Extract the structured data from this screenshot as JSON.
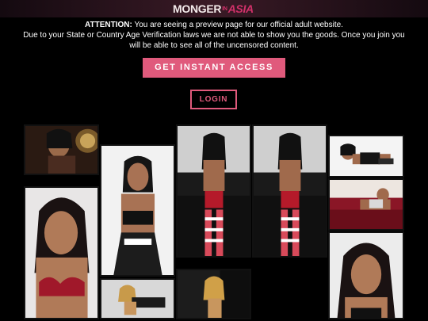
{
  "logo": {
    "part1": "MONGER",
    "part2": "IN",
    "part3": "ASIA"
  },
  "notice": {
    "attention_label": "ATTENTION:",
    "line1_rest": " You are seeing a preview page for our official adult website.",
    "line2": "Due to your State or Country Age Verification laws we are not able to show you the goods. Once you join you",
    "line3": "will be able to see all of the uncensored content."
  },
  "buttons": {
    "access_label": "GET INSTANT ACCESS",
    "login_label": "LOGIN"
  },
  "colors": {
    "accent": "#e05a7c",
    "background": "#000000"
  },
  "gallery": {
    "images": [
      "maid-costume-photo",
      "portrait-red-lingerie-photo",
      "black-lingerie-photo",
      "striped-stockings-photo",
      "striped-stockings-photo-2",
      "reclining-photo",
      "red-couch-photo",
      "portrait-photo",
      "blonde-photo",
      "doorway-photo"
    ]
  }
}
